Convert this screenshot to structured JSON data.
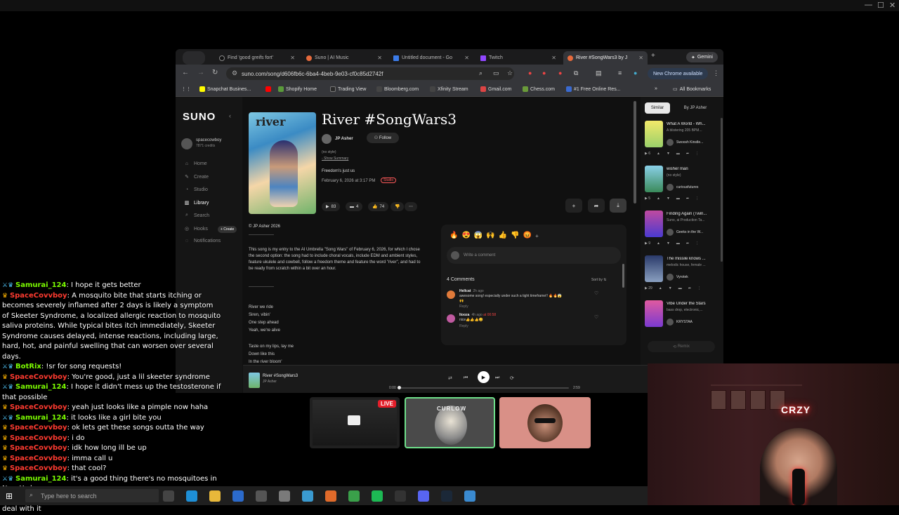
{
  "obs": {
    "minimize": "—",
    "maximize": "☐",
    "close": "✕"
  },
  "browser": {
    "tabs": [
      {
        "label": "Find 'good greifs fort'",
        "icon": "tiktok-icon",
        "color": "#111"
      },
      {
        "label": "Suno | AI Music",
        "icon": "suno-icon",
        "color": "#e66a3c"
      },
      {
        "label": "Untitled document - Go",
        "icon": "docs-icon",
        "color": "#3b7be8"
      },
      {
        "label": "Twitch",
        "icon": "twitch-icon",
        "color": "#9147ff"
      },
      {
        "label": "River #SongWars3 by J",
        "icon": "suno-icon",
        "color": "#e66a3c"
      }
    ],
    "gemini": "Gemini",
    "new_tab": "+",
    "url": "suno.com/song/d606fb6c-6ba4-4beb-9e03-cf0c85d2742f",
    "new_chrome": "New Chrome available",
    "bookmarks": [
      {
        "label": "Snapchat Busines...",
        "color": "#fffc00"
      },
      {
        "label": "",
        "color": "#ff0000"
      },
      {
        "label": "Shopify Home",
        "color": "#5a9a3a"
      },
      {
        "label": "Trading View",
        "color": "#2a2a2a"
      },
      {
        "label": "Bloomberg.com",
        "color": "#444"
      },
      {
        "label": "Xfinity Stream",
        "color": "#444"
      },
      {
        "label": "Gmail.com",
        "color": "#d44"
      },
      {
        "label": "Chess.com",
        "color": "#6a9a3a"
      },
      {
        "label": "#1 Free Online Res...",
        "color": "#3a6ad0"
      }
    ],
    "all_bookmarks": "All Bookmarks"
  },
  "suno": {
    "logo": "SUNO",
    "user": {
      "name": "spacecowboy",
      "credits": "7871 credits"
    },
    "nav": [
      {
        "label": "Home",
        "icon": "home-icon"
      },
      {
        "label": "Create",
        "icon": "create-icon"
      },
      {
        "label": "Studio",
        "icon": "studio-icon"
      },
      {
        "label": "Library",
        "icon": "library-icon"
      },
      {
        "label": "Search",
        "icon": "search-icon"
      },
      {
        "label": "Hooks",
        "icon": "hooks-icon"
      },
      {
        "label": "Notifications",
        "icon": "bell-icon"
      }
    ],
    "create_pill": "+ Create",
    "song": {
      "cover_text": "river",
      "title": "River #SongWars3",
      "artist": "JP Asher",
      "follow": "Follow",
      "style": "(no style)",
      "show_summary": "- Show Summary",
      "tagline": "Freedom's just us",
      "date": "February 6, 2026 at 3:17 PM",
      "studio_badge": "Studio",
      "plays": "83",
      "comments": "4",
      "likes": "74"
    },
    "copyright": "© JP Asher 2026",
    "rule": "——————",
    "description": "This song is my entry to the AI Umbrella \"Song Wars\" of February 6, 2026, for which I chose the second option: the song had to include choral vocals, include EDM and ambient styles, feature ukulele and cowbell, follow a freedom theme and feature the word \"river\", and had to be ready from scratch within a bit over an hour.",
    "lyrics": [
      "River we ride",
      "Siren, vibin'",
      "One step ahead",
      "Yeah, we're alive",
      "",
      "Taste on my lips, lay me",
      "Down like this",
      "In the river bloom'"
    ],
    "comments_panel": {
      "emojis": [
        "🔥",
        "😍",
        "😱",
        "🙌",
        "👍",
        "👎",
        "😡",
        "+"
      ],
      "placeholder": "Write a comment",
      "count": "4 Comments",
      "sort": "Sort by",
      "items": [
        {
          "user": "Hellcat",
          "time": "2h ago",
          "text": "awesome song! especially under such a tight timeframe!! 🔥🔥😱",
          "text2": "🙌",
          "reply": "Reply",
          "color": "#e07a3a"
        },
        {
          "user": "Itooza",
          "time": "4h ago",
          "text": "nice👍👍👍😊",
          "extra": "at 00:58",
          "reply": "Reply",
          "color": "#c05aa0"
        }
      ]
    },
    "right_panel": {
      "tab_similar": "Similar",
      "tab_by": "By JP Asher",
      "songs": [
        {
          "title": "What A World - Wh...",
          "sub": "A blistering 205 BPM...",
          "artist": "Swoosh Kinstle...",
          "plays": "6",
          "colors": [
            "#f2e96a",
            "#9ad06a"
          ]
        },
        {
          "title": "wisher man",
          "sub": "(no style)",
          "artist": "curiousfutures",
          "plays": "5",
          "colors": [
            "#8ad0e8",
            "#3a8a5a"
          ]
        },
        {
          "title": "Finding Again (Twin...",
          "sub": "Suno, ai Production Ta...",
          "artist": "Geeks in the W...",
          "plays": "9",
          "colors": [
            "#c04aa0",
            "#4a3ad0"
          ]
        },
        {
          "title": "The missile knows ...",
          "sub": "melodic house, female ...",
          "artist": "Vyrotek",
          "plays": "29",
          "colors": [
            "#2a3a6a",
            "#8aa0c0"
          ]
        },
        {
          "title": "Vibe Under the Stars",
          "sub": "bass drop, electronic,...",
          "artist": "KRYSTAA",
          "plays": "",
          "colors": [
            "#e05aa0",
            "#7a3ad0"
          ]
        }
      ],
      "remix": "Remix"
    },
    "player": {
      "title": "River #SongWars3",
      "artist": "JP Asher",
      "time_start": "0:00",
      "time_end": "2:59",
      "progress": 0.0
    }
  },
  "chat": [
    {
      "user": "Samurai_124",
      "msg": "I hope it gets better",
      "type": "sam"
    },
    {
      "user": "SpaceCovvboy",
      "msg": "A mosquito bite that starts itching or becomes severely inflamed after 2 days is likely a symptom of Skeeter Syndrome, a localized allergic reaction to mosquito saliva proteins. While typical bites itch immediately, Skeeter Syndrome causes delayed, intense reactions, including large, hard, hot, and painful swelling that can worsen over several days.",
      "type": "space"
    },
    {
      "user": "BotRix",
      "msg": "!sr for song requests!",
      "type": "bot"
    },
    {
      "user": "SpaceCovvboy",
      "msg": "You're good, just a lil skeeter syndrome",
      "type": "space"
    },
    {
      "user": "Samurai_124",
      "msg": "I hope it didn't mess up the testosterone if that possible",
      "type": "sam"
    },
    {
      "user": "SpaceCovvboy",
      "msg": "yeah just looks like a pimple now haha",
      "type": "space"
    },
    {
      "user": "Samurai_124",
      "msg": "it looks like a girl bite you",
      "type": "sam"
    },
    {
      "user": "SpaceCovvboy",
      "msg": "ok lets get these songs outta the way",
      "type": "space"
    },
    {
      "user": "SpaceCovvboy",
      "msg": "i do",
      "type": "space"
    },
    {
      "user": "SpaceCovvboy",
      "msg": "idk how long ill be up",
      "type": "space"
    },
    {
      "user": "SpaceCovvboy",
      "msg": "imma call u",
      "type": "space"
    },
    {
      "user": "SpaceCovvboy",
      "msg": "that cool?",
      "type": "space"
    },
    {
      "user": "Samurai_124",
      "msg": "it's a good thing there's no mosquitoes in New York",
      "type": "sam"
    },
    {
      "user": "Samurai_124",
      "msg": "damn will get a sexy voice all of the homo deal with it",
      "type": "sam"
    }
  ],
  "stream": {
    "live": "LIVE",
    "cam2_label": "CURLOW",
    "neon": "CRZY"
  },
  "taskbar": {
    "search_placeholder": "Type here to search",
    "apps": [
      {
        "icon": "task-view-icon",
        "color": "#444"
      },
      {
        "icon": "edge-icon",
        "color": "#1e8fd6"
      },
      {
        "icon": "file-explorer-icon",
        "color": "#e8b83a"
      },
      {
        "icon": "outlook-icon",
        "color": "#2b6acb"
      },
      {
        "icon": "calculator-icon",
        "color": "#555"
      },
      {
        "icon": "app-icon",
        "color": "#7a7a7a"
      },
      {
        "icon": "notepad-icon",
        "color": "#3a9ad0"
      },
      {
        "icon": "brave-icon",
        "color": "#e06a2a"
      },
      {
        "icon": "chrome-icon",
        "color": "#3aa04a"
      },
      {
        "icon": "spotify-icon",
        "color": "#1db954"
      },
      {
        "icon": "obs-icon",
        "color": "#333"
      },
      {
        "icon": "discord-icon",
        "color": "#5865f2"
      },
      {
        "icon": "steam-icon",
        "color": "#1b2838"
      },
      {
        "icon": "paint-icon",
        "color": "#3a8ad0"
      }
    ]
  }
}
